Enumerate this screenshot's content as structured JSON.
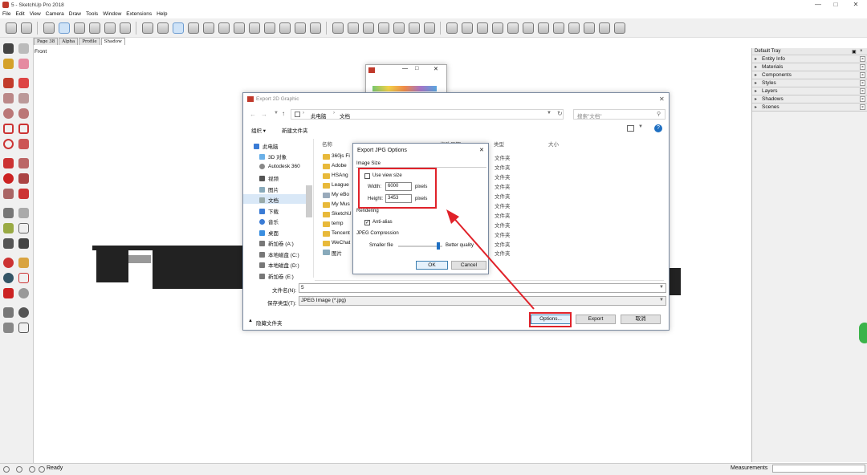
{
  "app": {
    "title": "5 - SketchUp Pro 2018",
    "view_label": "Front",
    "status": "Ready",
    "measurements_label": "Measurements"
  },
  "menu": [
    "File",
    "Edit",
    "View",
    "Camera",
    "Draw",
    "Tools",
    "Window",
    "Extensions",
    "Help"
  ],
  "scene_tabs": [
    "Page 38",
    "Alpha",
    "Profile",
    "Shadow"
  ],
  "tray": {
    "title": "Default Tray",
    "panels": [
      "Entity Info",
      "Materials",
      "Components",
      "Styles",
      "Layers",
      "Shadows",
      "Scenes"
    ]
  },
  "export_dialog": {
    "title": "Export 2D Graphic",
    "path": [
      "此电脑",
      "文档"
    ],
    "search_placeholder": "搜索\"文档\"",
    "organize": "组织 ▾",
    "new_folder": "新建文件夹",
    "columns": {
      "name": "名称",
      "modified": "修改日期",
      "type": "类型",
      "size": "大小"
    },
    "nav": [
      "此电脑",
      "3D 对象",
      "Autodesk 360",
      "视频",
      "图片",
      "文档",
      "下载",
      "音乐",
      "桌面",
      "新加卷 (A:)",
      "本地磁盘 (C:)",
      "本地磁盘 (D:)",
      "新加卷 (E:)"
    ],
    "files": [
      {
        "name": "360js Fi",
        "type": "文件夹"
      },
      {
        "name": "Adobe",
        "type": "文件夹"
      },
      {
        "name": "HSAng",
        "type": "文件夹"
      },
      {
        "name": "League",
        "type": "文件夹"
      },
      {
        "name": "My eBo",
        "type": "文件夹"
      },
      {
        "name": "My Mus",
        "type": "文件夹"
      },
      {
        "name": "SketchU",
        "type": "文件夹"
      },
      {
        "name": "temp",
        "type": "文件夹"
      },
      {
        "name": "Tencent",
        "type": "文件夹"
      },
      {
        "name": "WeChat",
        "type": "文件夹"
      },
      {
        "name": "图片",
        "type": "文件夹"
      }
    ],
    "filename_label": "文件名(N):",
    "filename_value": "5",
    "filetype_label": "保存类型(T):",
    "filetype_value": "JPEG Image (*.jpg)",
    "hide_folders": "隐藏文件夹",
    "options_button": "Options...",
    "export_button": "Export",
    "cancel_button": "取消"
  },
  "jpg_dialog": {
    "title": "Export JPG Options",
    "image_size_group": "Image Size",
    "use_view_size": "Use view size",
    "width_label": "Width:",
    "width_value": "6000",
    "height_label": "Height:",
    "height_value": "3453",
    "unit": "pixels",
    "rendering_group": "Rendering",
    "anti_alias": "Anti-alias",
    "compression_group": "JPEG Compression",
    "smaller_file": "Smaller file",
    "better_quality": "Better quality",
    "compression_level": 0.9,
    "ok": "OK",
    "cancel": "Cancel"
  },
  "colors": {
    "highlight": "#e0222a",
    "folder": "#e8b93a",
    "dialog_border": "#7a8aa0"
  }
}
